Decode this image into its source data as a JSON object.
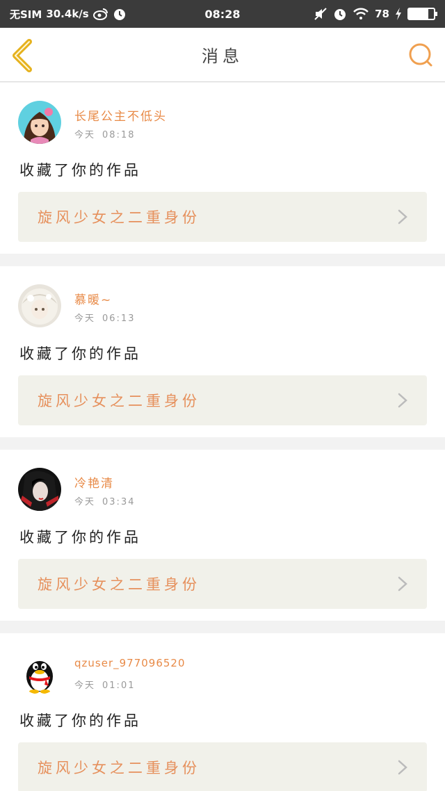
{
  "status_bar": {
    "carrier": "无SIM",
    "speed": "30.4k/s",
    "time": "08:28",
    "battery": "78",
    "battery_level": 0.78,
    "icons": [
      "weibo-icon",
      "alarm-icon",
      "mute-icon",
      "alarm-icon",
      "wifi-icon",
      "charging-icon",
      "battery-icon"
    ]
  },
  "header": {
    "title": "消息",
    "back_icon": "chevron-left-icon",
    "search_icon": "search-icon",
    "accent_color": "#e6b21f",
    "search_color": "#f0a050"
  },
  "messages": [
    {
      "username": "长尾公主不低头",
      "day": "今天",
      "time": "08:18",
      "action": "收藏了你的作品",
      "work_title": "旋风少女之二重身份"
    },
    {
      "username": "慕暖~",
      "day": "今天",
      "time": "06:13",
      "action": "收藏了你的作品",
      "work_title": "旋风少女之二重身份"
    },
    {
      "username": "冷艳清",
      "day": "今天",
      "time": "03:34",
      "action": "收藏了你的作品",
      "work_title": "旋风少女之二重身份"
    },
    {
      "username": "qzuser_977096520",
      "day": "今天",
      "time": "01:01",
      "action": "收藏了你的作品",
      "work_title": "旋风少女之二重身份"
    }
  ]
}
